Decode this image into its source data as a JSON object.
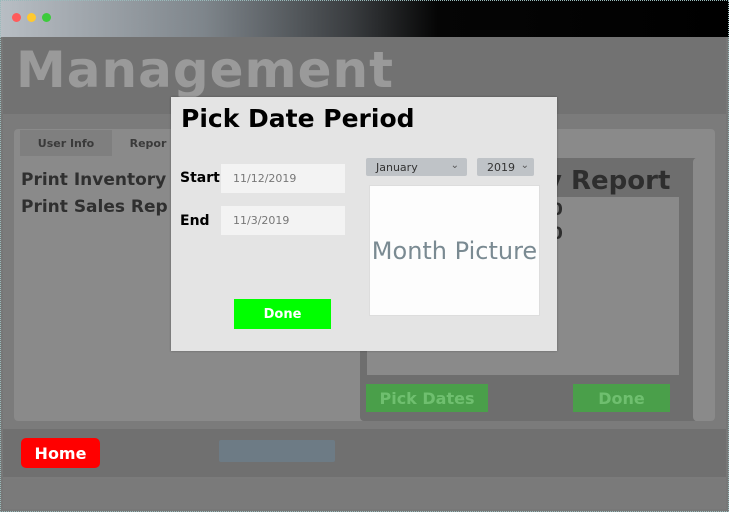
{
  "window": {
    "controls": [
      "close",
      "minimize",
      "maximize"
    ]
  },
  "app": {
    "title": "Management"
  },
  "tabs": [
    {
      "label": "User Info",
      "active": false
    },
    {
      "label": "Repor",
      "active": true
    }
  ],
  "left_panel": {
    "items": [
      "Print Inventory",
      "Print Sales Rep"
    ]
  },
  "right_panel": {
    "title": "y Report",
    "line1": "0",
    "line2": "0",
    "pick_dates_label": "Pick Dates",
    "done_label": "Done"
  },
  "bottom": {
    "home_label": "Home"
  },
  "dialog": {
    "title": "Pick Date Period",
    "start_label": "Start",
    "start_value": "11/12/2019",
    "end_label": "End",
    "end_value": "11/3/2019",
    "month_select": "January",
    "year_select": "2019",
    "month_picture": "Month Picture",
    "done_label": "Done"
  },
  "colors": {
    "accent_green": "#00ff00",
    "home_red": "#ff0000",
    "dim_green": "#4a9f4a"
  }
}
